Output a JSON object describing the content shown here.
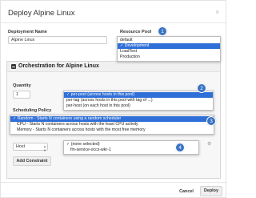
{
  "dialog": {
    "title": "Deploy Alpine Linux",
    "close_glyph": "×"
  },
  "deployment": {
    "label": "Deployment Name",
    "value": "Alpine Linux"
  },
  "resource_pool": {
    "label": "Resource Pool",
    "options": [
      "default",
      "Development",
      "LoadTest",
      "Production"
    ],
    "selected": "Development",
    "badge": "1"
  },
  "orchestration": {
    "title": "Orchestration for Alpine Linux",
    "quantity": {
      "label": "Quantity",
      "value": "1",
      "options": [
        "per-pool (across hosts in this pool)",
        "per-tag (across hosts in this pool with tag of ...)",
        "per-host (on each host in this pool)"
      ],
      "badge": "2"
    },
    "scheduling": {
      "label": "Scheduling Policy",
      "options": [
        "Random - Starts N containers using a random scheduler",
        "CPU - Starts N containers across hosts with the least CPU activity",
        "Memory - Starts N containers across hosts with the most free memory"
      ],
      "badge": "3"
    },
    "constraint": {
      "type_value": "Host",
      "options": [
        "(none selected)",
        "fm-service-occs-wkr-1"
      ],
      "badge": "4",
      "add_label": "Add Constraint"
    }
  },
  "footer": {
    "cancel_label": "Cancel",
    "deploy_label": "Deploy"
  }
}
